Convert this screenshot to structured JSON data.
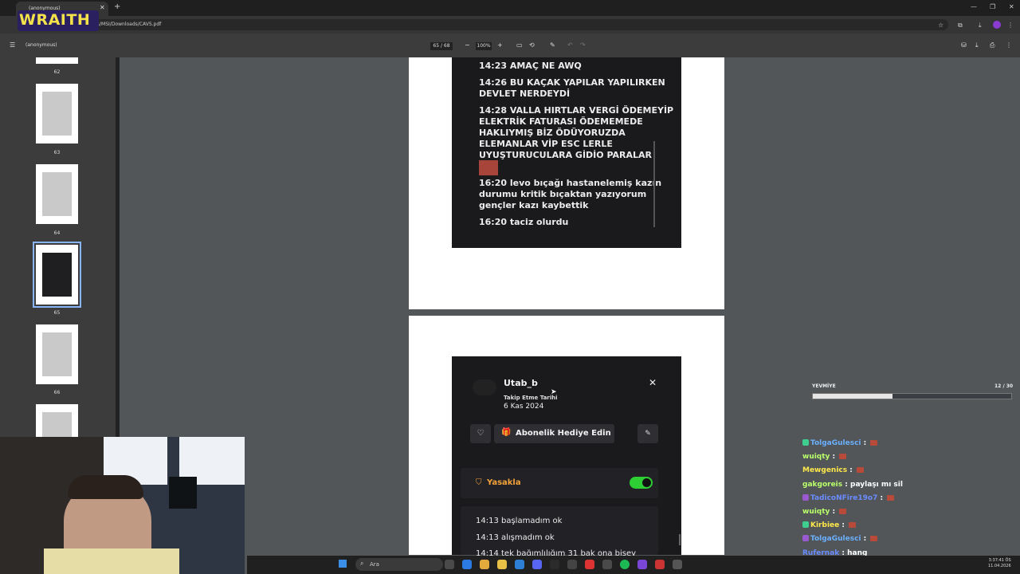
{
  "overlay": {
    "brand": "WRAITH"
  },
  "browser": {
    "tab_title": "(anonymous)",
    "address": "C:/Users/MSI/Downloads/CAVS.pdf"
  },
  "pdf_toolbar": {
    "doc_title": "(anonymous)",
    "page_current": "65",
    "page_total": "/ 68",
    "zoom": "100%"
  },
  "thumbnails": [
    {
      "num": "62"
    },
    {
      "num": "63"
    },
    {
      "num": "64"
    },
    {
      "num": "65",
      "selected": true
    },
    {
      "num": "66"
    }
  ],
  "page1": {
    "lines": [
      "14:23 AMAÇ NE AWQ",
      "14:26 BU KAÇAK YAPILAR YAPILIRKEN",
      "DEVLET NERDEYDİ",
      "14:28 VALLA HIRTLAR VERGİ ÖDEMEYİP",
      "ELEKTRİK FATURASI ÖDEMEMEDE",
      "HAKLIYMIŞ BİZ ÖDÜYORUZDA",
      "ELEMANLAR VİP ESC LERLE",
      "UYUŞTURUCULARA GİDİO PARALAR",
      "16:20 levo bıçağı hastanelemiş kazın",
      "durumu kritik bıçaktan yazıyorum",
      "gençler kazı kaybettik",
      "16:20 taciz olurdu"
    ]
  },
  "page2": {
    "username": "Utab_b",
    "follow_label": "Takip Etme Tarihi",
    "follow_date": "6 Kas 2024",
    "gift_label": "Abonelik Hediye Edin",
    "ban_label": "Yasakla",
    "lines": [
      "14:13 başlamadım ok",
      "14:13 alışmadım ok",
      "14:14 tek bağımlılığım 31 bak ona bisey"
    ]
  },
  "progress": {
    "label": "YEVMİYE",
    "count": "12 / 30",
    "fraction": 0.4
  },
  "chat": [
    {
      "user": "TolgaGulesci",
      "msg": "",
      "color": "#6ab0ff"
    },
    {
      "user": "wuiqty",
      "msg": "",
      "color": "#b9ff6a"
    },
    {
      "user": "Mewgenics",
      "msg": "",
      "color": "#ffe94a"
    },
    {
      "user": "gakgoreis",
      "msg": "paylaşı mı sil",
      "color": "#b9ff6a"
    },
    {
      "user": "TadicoNFire19o7",
      "msg": "",
      "color": "#6a8cff"
    },
    {
      "user": "wuiqty",
      "msg": "",
      "color": "#b9ff6a"
    },
    {
      "user": "Kirbiee",
      "msg": "",
      "color": "#ffe94a"
    },
    {
      "user": "TolgaGulesci",
      "msg": "",
      "color": "#6ab0ff"
    },
    {
      "user": "Rufernak",
      "msg": "hang",
      "color": "#6a8cff"
    },
    {
      "user": "Garza_aa",
      "msg": "",
      "color": "#ff9b4a"
    }
  ],
  "taskbar": {
    "search": "Ara",
    "time": "3:37:41 ÖS",
    "date": "11.04.2026"
  }
}
